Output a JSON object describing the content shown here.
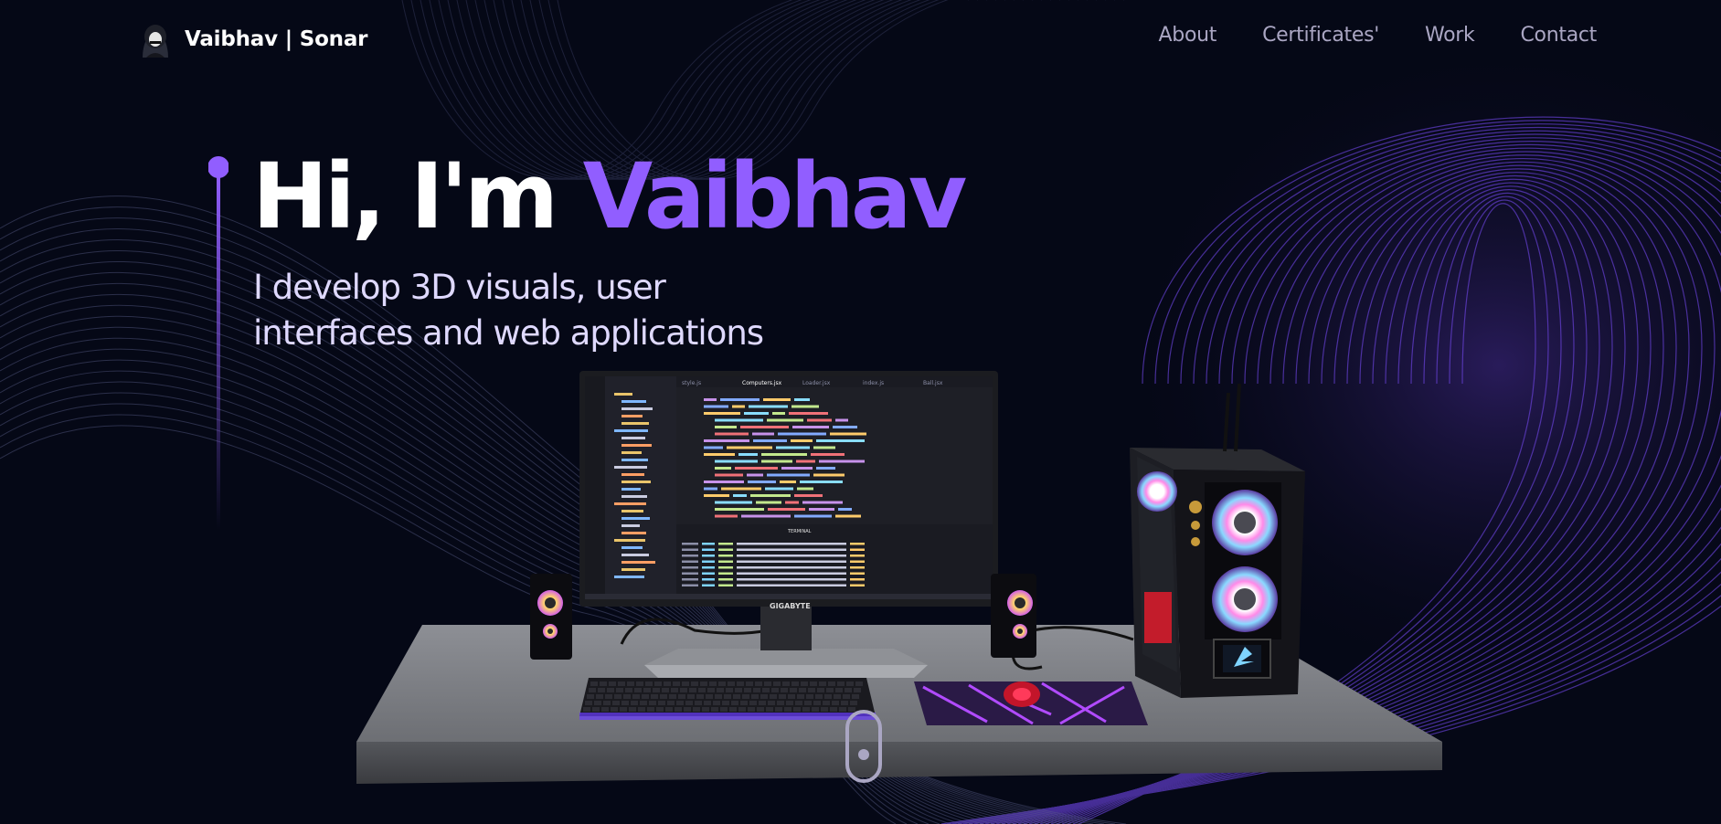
{
  "brand": {
    "name": "Vaibhav | Sonar",
    "avatar_icon": "hooded-avatar-icon"
  },
  "nav": {
    "links": [
      {
        "label": "About"
      },
      {
        "label": "Certificates'"
      },
      {
        "label": "Work"
      },
      {
        "label": "Contact"
      }
    ]
  },
  "hero": {
    "greeting": "Hi, I'm ",
    "name": "Vaibhav",
    "subtitle_line1": "I develop 3D visuals, user",
    "subtitle_line2": "interfaces and web applications"
  },
  "scene": {
    "monitor_brand": "GIGABYTE",
    "editor_tabs": [
      "style.js",
      "Computers.jsx",
      "Loader.jsx",
      "index.js",
      "Ball.jsx"
    ],
    "terminal_label": "TERMINAL"
  },
  "colors": {
    "background": "#050816",
    "accent": "#915eff",
    "nav_text": "#aaa6c3",
    "subtitle": "#dfd9ff"
  },
  "icons": {
    "scroll": "mouse-scroll-icon",
    "accent_dot": "accent-dot-icon"
  }
}
